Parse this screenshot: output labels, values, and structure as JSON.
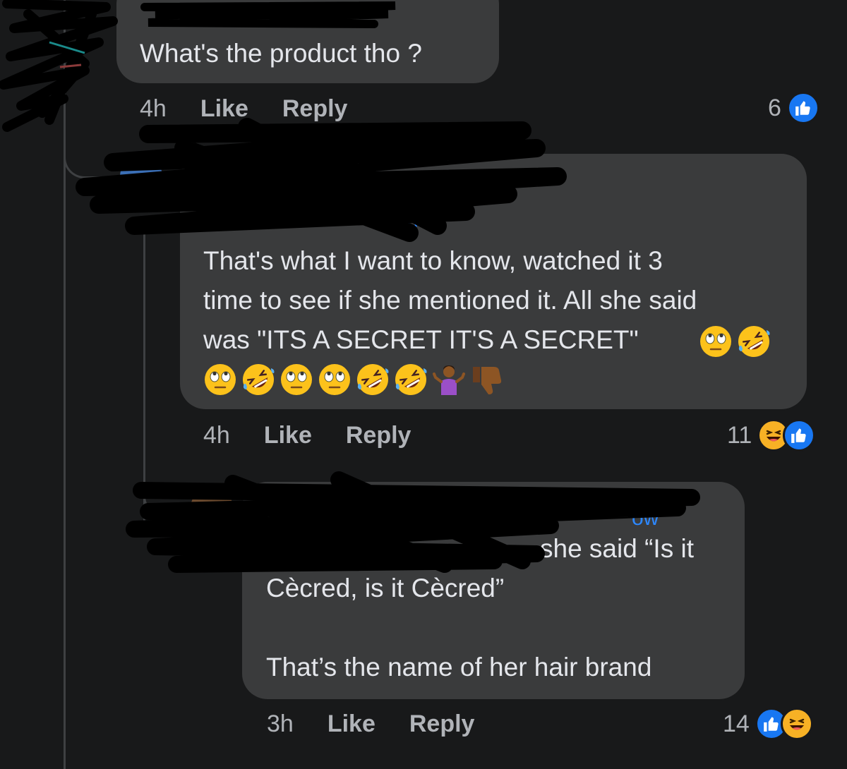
{
  "comments": [
    {
      "text": "What's the product tho ?",
      "time": "4h",
      "like_label": "Like",
      "reply_label": "Reply",
      "reaction_count": "6",
      "reactions": [
        "like"
      ]
    },
    {
      "text": "That's what I want to know, watched it 3\ntime to see if she mentioned it. All she said\nwas \"ITS A SECRET IT'S A SECRET\"",
      "emojis_line1": [
        "face-with-rolling-eyes",
        "rolling-on-floor-laughing"
      ],
      "emojis_line2": [
        "face-with-rolling-eyes",
        "rolling-on-floor-laughing",
        "face-with-rolling-eyes",
        "face-with-rolling-eyes",
        "rolling-on-floor-laughing",
        "rolling-on-floor-laughing",
        "person-shrugging",
        "thumbs-down"
      ],
      "time": "4h",
      "like_label": "Like",
      "reply_label": "Reply",
      "reaction_count": "11",
      "reactions": [
        "haha",
        "like"
      ]
    },
    {
      "text_line1": "she said “Is it",
      "text_line2": "Cècred, is it Cècred”",
      "text_line3": "That’s the name of her hair brand",
      "time": "3h",
      "like_label": "Like",
      "reply_label": "Reply",
      "reaction_count": "14",
      "reactions": [
        "like",
        "haha"
      ]
    }
  ],
  "colors": {
    "background": "#18191a",
    "bubble": "#3a3b3c",
    "text": "#e4e6eb",
    "meta": "#b0b3b8",
    "like_blue": "#1877f2",
    "haha_yellow": "#f7b125",
    "redaction": "#000000"
  }
}
